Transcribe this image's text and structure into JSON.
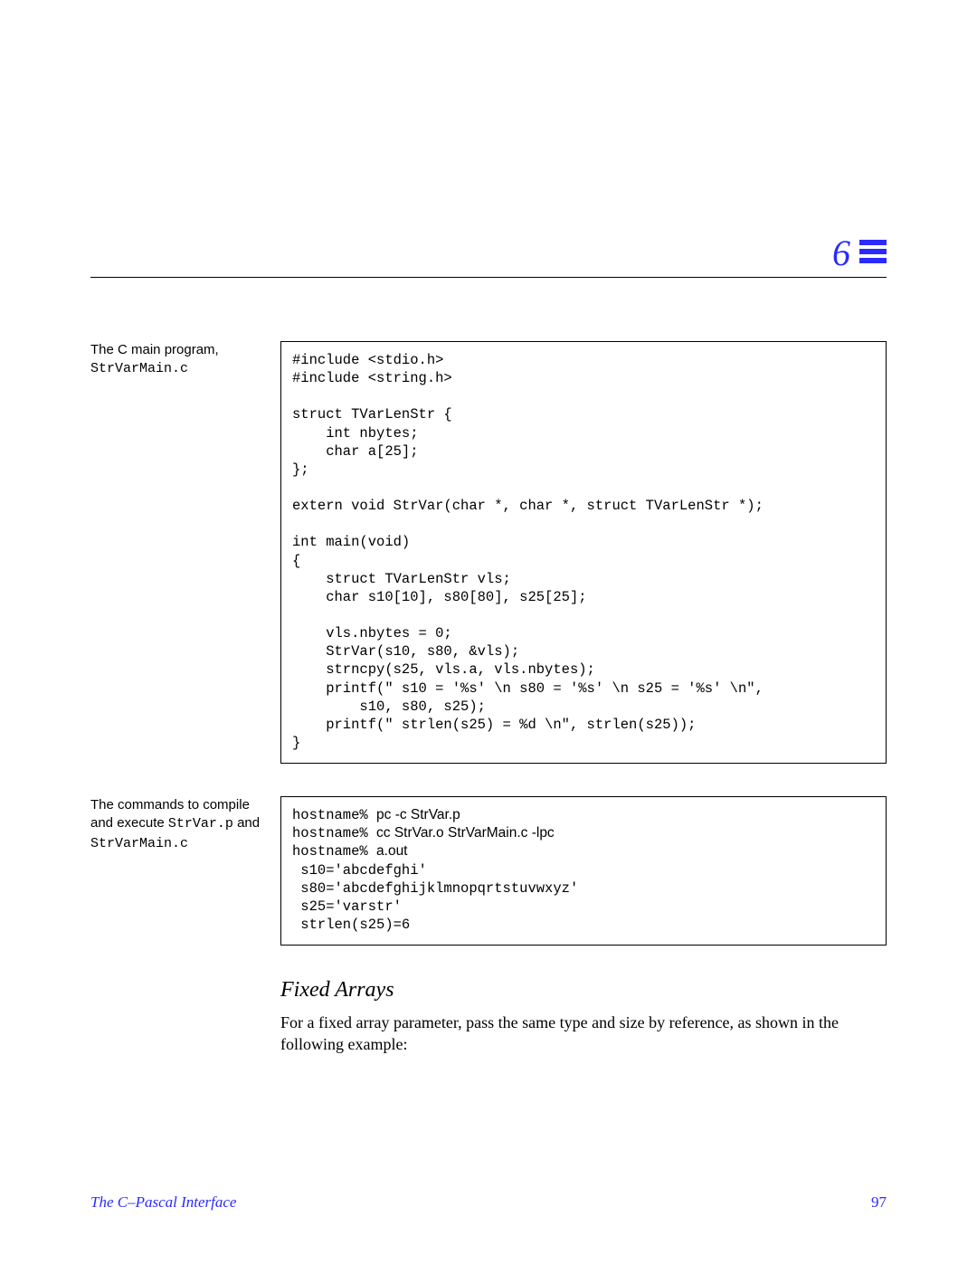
{
  "chapter": {
    "number": "6"
  },
  "label1": {
    "prefix": "The C main program, ",
    "filename": "StrVarMain.c"
  },
  "code1": "#include <stdio.h>\n#include <string.h>\n\nstruct TVarLenStr {\n    int nbytes;\n    char a[25];\n};\n\nextern void StrVar(char *, char *, struct TVarLenStr *);\n\nint main(void)\n{\n    struct TVarLenStr vls;\n    char s10[10], s80[80], s25[25];\n\n    vls.nbytes = 0;\n    StrVar(s10, s80, &vls);\n    strncpy(s25, vls.a, vls.nbytes);\n    printf(\" s10 = '%s' \\n s80 = '%s' \\n s25 = '%s' \\n\",\n        s10, s80, s25);\n    printf(\" strlen(s25) = %d \\n\", strlen(s25));\n}",
  "label2": {
    "prefix": "The commands to compile and execute ",
    "file1": "StrVar.p",
    "mid": " and ",
    "file2": "StrVarMain.c"
  },
  "cmd": {
    "p1": "hostname% ",
    "c1": "pc -c StrVar.p",
    "p2": "hostname% ",
    "c2": "cc StrVar.o StrVarMain.c -lpc",
    "p3": "hostname% ",
    "c3": "a.out",
    "out": " s10='abcdefghi'\n s80='abcdefghijklmnopqrtstuvwxyz'\n s25='varstr'\n strlen(s25)=6"
  },
  "subsection": {
    "title": "Fixed Arrays"
  },
  "body": {
    "para1": "For a fixed array parameter, pass the same type and size by reference, as shown in the following example:"
  },
  "footer": {
    "title": "The C–Pascal Interface",
    "page": "97"
  }
}
